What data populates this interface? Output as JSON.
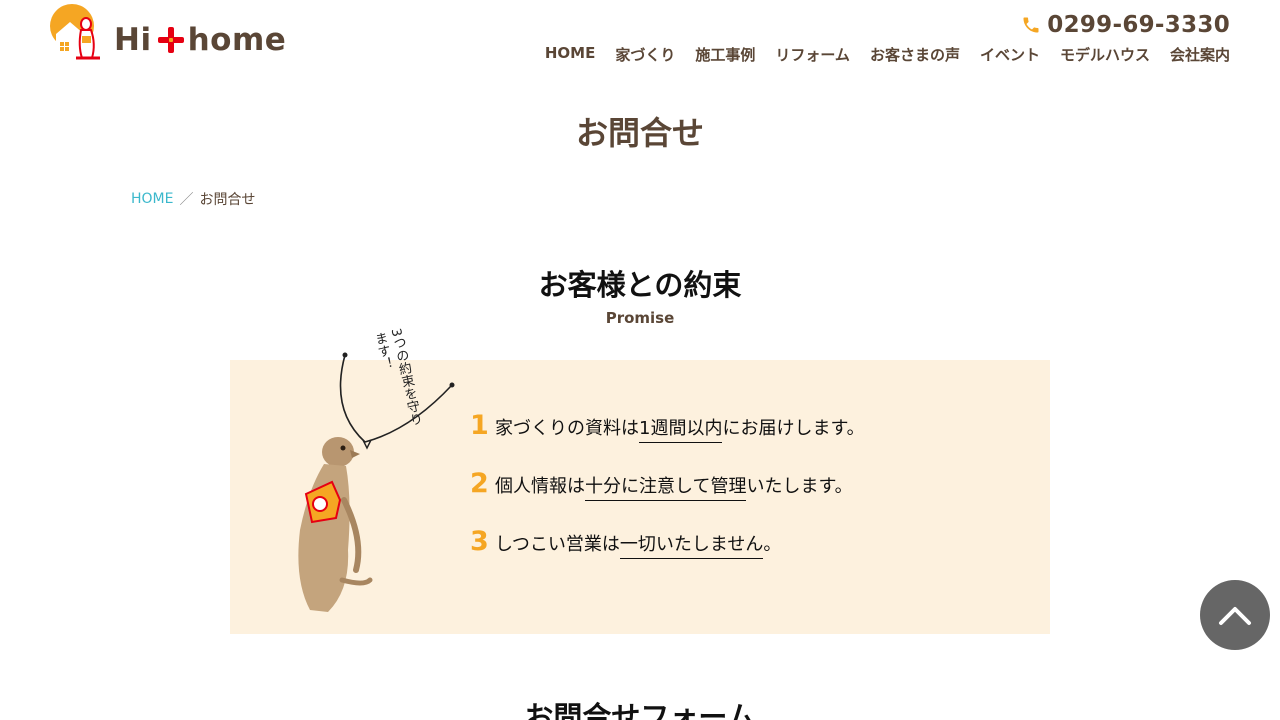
{
  "header": {
    "logo_text_left": "Hi",
    "logo_text_right": "home",
    "phone": "0299-69-3330",
    "nav": [
      "HOME",
      "家づくり",
      "施工事例",
      "リフォーム",
      "お客さまの声",
      "イベント",
      "モデルハウス",
      "会社案内"
    ]
  },
  "page": {
    "title": "お問合せ",
    "breadcrumb": {
      "home": "HOME",
      "separator": "／",
      "current": "お問合せ"
    }
  },
  "promise": {
    "title": "お客様との約束",
    "subtitle": "Promise",
    "bubble": "3つの約束を守ります！",
    "items": [
      {
        "num": "1",
        "pre": "家づくりの資料は",
        "underline": "1週間以内",
        "post": "にお届けします。"
      },
      {
        "num": "2",
        "pre": "個人情報は",
        "underline": "十分に注意して管理",
        "post": "いたします。"
      },
      {
        "num": "3",
        "pre": "しつこい営業は",
        "underline": "一切いたしません",
        "post": "。"
      }
    ]
  },
  "form": {
    "title": "お問合せフォーム"
  },
  "colors": {
    "brown": "#5a4636",
    "accent": "#f5a623",
    "red": "#e60012",
    "link": "#3bb8cc",
    "box_bg": "#fdf1de"
  },
  "icons": {
    "phone": "phone-icon",
    "scroll_top": "chevron-up-icon",
    "logo": "meerkat-house-logo"
  }
}
